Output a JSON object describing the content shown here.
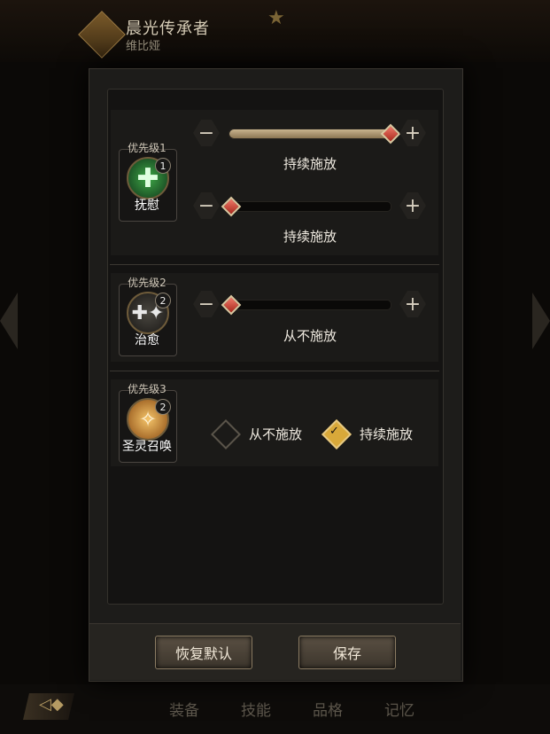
{
  "background": {
    "title": "晨光传承者",
    "subtitle": "维比娅",
    "tabs": [
      "装备",
      "技能",
      "品格",
      "记忆"
    ]
  },
  "skills": [
    {
      "priority_label": "优先级1",
      "name": "抚慰",
      "level": "1",
      "icon": "heal-cross-icon",
      "sliders": [
        {
          "value": 1.0,
          "label": "持续施放"
        },
        {
          "value": 0.0,
          "label": "持续施放"
        }
      ]
    },
    {
      "priority_label": "优先级2",
      "name": "治愈",
      "level": "2",
      "icon": "sparkle-heal-icon",
      "sliders": [
        {
          "value": 0.0,
          "label": "从不施放"
        }
      ]
    },
    {
      "priority_label": "优先级3",
      "name": "圣灵召唤",
      "level": "2",
      "icon": "holy-summon-icon",
      "options": [
        {
          "label": "从不施放",
          "selected": false
        },
        {
          "label": "持续施放",
          "selected": true
        }
      ]
    }
  ],
  "buttons": {
    "restore": "恢复默认",
    "save": "保存"
  },
  "colors": {
    "slider_fill": "#c9b48e",
    "knob": "#d84a3a",
    "radio_selected": "#d9a93a"
  }
}
